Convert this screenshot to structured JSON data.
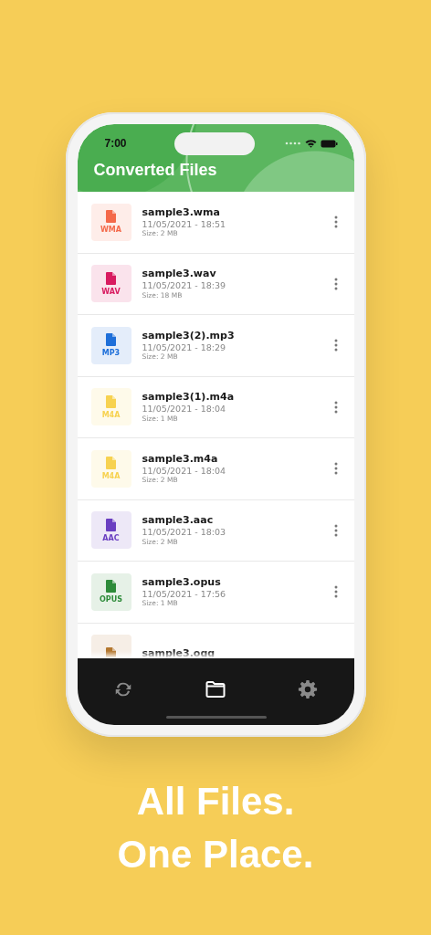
{
  "status_bar": {
    "time": "7:00"
  },
  "header": {
    "title": "Converted Files"
  },
  "files": [
    {
      "name": "sample3.wma",
      "date": "11/05/2021 - 18:51",
      "size": "Size: 2 MB",
      "format": "WMA",
      "color": "#f4694a"
    },
    {
      "name": "sample3.wav",
      "date": "11/05/2021 - 18:39",
      "size": "Size: 18 MB",
      "format": "WAV",
      "color": "#d81b60"
    },
    {
      "name": "sample3(2).mp3",
      "date": "11/05/2021 - 18:29",
      "size": "Size: 2 MB",
      "format": "MP3",
      "color": "#1e6fd9"
    },
    {
      "name": "sample3(1).m4a",
      "date": "11/05/2021 - 18:04",
      "size": "Size: 1 MB",
      "format": "M4A",
      "color": "#f7d250"
    },
    {
      "name": "sample3.m4a",
      "date": "11/05/2021 - 18:04",
      "size": "Size: 2 MB",
      "format": "M4A",
      "color": "#f7d250"
    },
    {
      "name": "sample3.aac",
      "date": "11/05/2021 - 18:03",
      "size": "Size: 2 MB",
      "format": "AAC",
      "color": "#6a3fc1"
    },
    {
      "name": "sample3.opus",
      "date": "11/05/2021 - 17:56",
      "size": "Size: 1 MB",
      "format": "OPUS",
      "color": "#2e8b3a"
    },
    {
      "name": "sample3.ogg",
      "color": "#b4772e"
    }
  ],
  "tabs": [
    {
      "kind": "convert",
      "selected": false
    },
    {
      "kind": "files",
      "selected": true
    },
    {
      "kind": "settings",
      "selected": false
    }
  ],
  "headline": [
    "All Files.",
    "One Place."
  ]
}
